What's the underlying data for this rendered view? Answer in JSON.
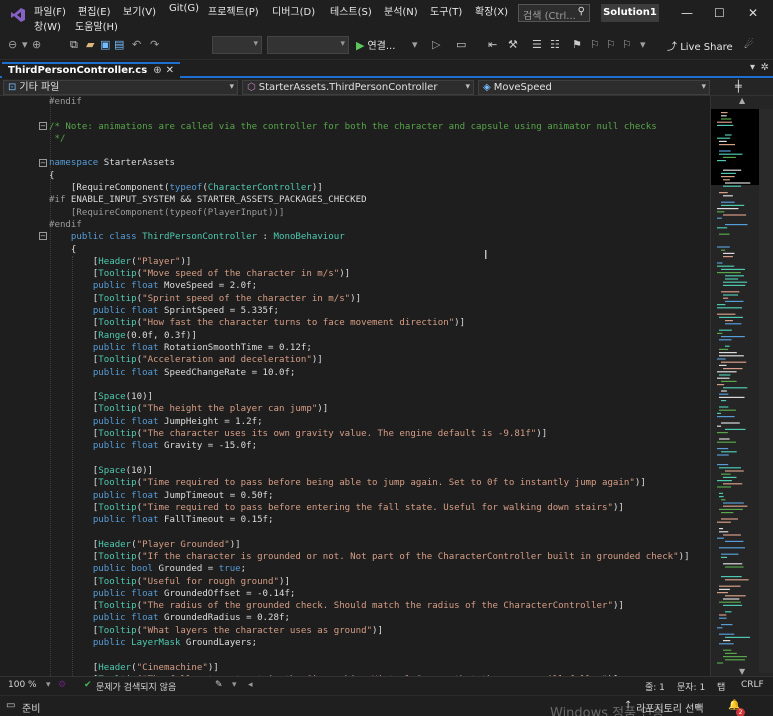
{
  "menu": [
    "파일(F)",
    "편집(E)",
    "보기(V)",
    "Git(G)",
    "프로젝트(P)",
    "디버그(D)",
    "테스트(S)",
    "분석(N)",
    "도구(T)",
    "확장(X)",
    "창(W)",
    "도움말(H)"
  ],
  "search": {
    "placeholder": "검색 (Ctrl...",
    "icon": "search-icon"
  },
  "solution_name": "Solution1",
  "window_controls": {
    "minimize": "—",
    "maximize": "☐",
    "close": "✕"
  },
  "toolbar": {
    "start_label": "연결...",
    "live_share": "Live Share"
  },
  "tab": {
    "title": "ThirdPersonController.cs",
    "pin": "⊕",
    "close": "✕"
  },
  "navbar": {
    "project": "기타 파일",
    "class": "StarterAssets.ThirdPersonController",
    "member": "MoveSpeed"
  },
  "code_lines": [
    [
      [
        "pp",
        "#endif"
      ]
    ],
    [
      [
        "tx",
        ""
      ]
    ],
    [
      [
        "cm",
        "/* Note: animations are called via the controller for both the character and capsule using animator null checks"
      ]
    ],
    [
      [
        "cm",
        " */"
      ]
    ],
    [
      [
        "tx",
        ""
      ]
    ],
    [
      [
        "kw",
        "namespace"
      ],
      [
        "tx",
        " StarterAssets"
      ]
    ],
    [
      [
        "tx",
        "{"
      ]
    ],
    [
      [
        "tx",
        "    [RequireComponent("
      ],
      [
        "kw",
        "typeof"
      ],
      [
        "tx",
        "("
      ],
      [
        "ty",
        "CharacterController"
      ],
      [
        "tx",
        ")]"
      ]
    ],
    [
      [
        "pp",
        "#if"
      ],
      [
        "tx",
        " ENABLE_INPUT_SYSTEM && STARTER_ASSETS_PACKAGES_CHECKED"
      ]
    ],
    [
      [
        "pp",
        "    [RequireComponent(typeof(PlayerInput))]"
      ]
    ],
    [
      [
        "pp",
        "#endif"
      ]
    ],
    [
      [
        "tx",
        "    "
      ],
      [
        "kw",
        "public class"
      ],
      [
        "tx",
        " "
      ],
      [
        "ty",
        "ThirdPersonController"
      ],
      [
        "tx",
        " : "
      ],
      [
        "ty",
        "MonoBehaviour"
      ]
    ],
    [
      [
        "tx",
        "    {"
      ]
    ],
    [
      [
        "tx",
        "        ["
      ],
      [
        "ty",
        "Header"
      ],
      [
        "tx",
        "("
      ],
      [
        "st",
        "\"Player\""
      ],
      [
        "tx",
        ")]"
      ]
    ],
    [
      [
        "tx",
        "        ["
      ],
      [
        "ty",
        "Tooltip"
      ],
      [
        "tx",
        "("
      ],
      [
        "st",
        "\"Move speed of the character in m/s\""
      ],
      [
        "tx",
        ")]"
      ]
    ],
    [
      [
        "tx",
        "        "
      ],
      [
        "kw",
        "public float"
      ],
      [
        "tx",
        " MoveSpeed = 2.0f;"
      ]
    ],
    [
      [
        "tx",
        "        ["
      ],
      [
        "ty",
        "Tooltip"
      ],
      [
        "tx",
        "("
      ],
      [
        "st",
        "\"Sprint speed of the character in m/s\""
      ],
      [
        "tx",
        ")]"
      ]
    ],
    [
      [
        "tx",
        "        "
      ],
      [
        "kw",
        "public float"
      ],
      [
        "tx",
        " SprintSpeed = 5.335f;"
      ]
    ],
    [
      [
        "tx",
        "        ["
      ],
      [
        "ty",
        "Tooltip"
      ],
      [
        "tx",
        "("
      ],
      [
        "st",
        "\"How fast the character turns to face movement direction\""
      ],
      [
        "tx",
        ")]"
      ]
    ],
    [
      [
        "tx",
        "        ["
      ],
      [
        "ty",
        "Range"
      ],
      [
        "tx",
        "(0.0f, 0.3f)]"
      ]
    ],
    [
      [
        "tx",
        "        "
      ],
      [
        "kw",
        "public float"
      ],
      [
        "tx",
        " RotationSmoothTime = 0.12f;"
      ]
    ],
    [
      [
        "tx",
        "        ["
      ],
      [
        "ty",
        "Tooltip"
      ],
      [
        "tx",
        "("
      ],
      [
        "st",
        "\"Acceleration and deceleration\""
      ],
      [
        "tx",
        ")]"
      ]
    ],
    [
      [
        "tx",
        "        "
      ],
      [
        "kw",
        "public float"
      ],
      [
        "tx",
        " SpeedChangeRate = 10.0f;"
      ]
    ],
    [
      [
        "tx",
        ""
      ]
    ],
    [
      [
        "tx",
        "        ["
      ],
      [
        "ty",
        "Space"
      ],
      [
        "tx",
        "(10)]"
      ]
    ],
    [
      [
        "tx",
        "        ["
      ],
      [
        "ty",
        "Tooltip"
      ],
      [
        "tx",
        "("
      ],
      [
        "st",
        "\"The height the player can jump\""
      ],
      [
        "tx",
        ")]"
      ]
    ],
    [
      [
        "tx",
        "        "
      ],
      [
        "kw",
        "public float"
      ],
      [
        "tx",
        " JumpHeight = 1.2f;"
      ]
    ],
    [
      [
        "tx",
        "        ["
      ],
      [
        "ty",
        "Tooltip"
      ],
      [
        "tx",
        "("
      ],
      [
        "st",
        "\"The character uses its own gravity value. The engine default is -9.81f\""
      ],
      [
        "tx",
        ")]"
      ]
    ],
    [
      [
        "tx",
        "        "
      ],
      [
        "kw",
        "public float"
      ],
      [
        "tx",
        " Gravity = -15.0f;"
      ]
    ],
    [
      [
        "tx",
        ""
      ]
    ],
    [
      [
        "tx",
        "        ["
      ],
      [
        "ty",
        "Space"
      ],
      [
        "tx",
        "(10)]"
      ]
    ],
    [
      [
        "tx",
        "        ["
      ],
      [
        "ty",
        "Tooltip"
      ],
      [
        "tx",
        "("
      ],
      [
        "st",
        "\"Time required to pass before being able to jump again. Set to 0f to instantly jump again\""
      ],
      [
        "tx",
        ")]"
      ]
    ],
    [
      [
        "tx",
        "        "
      ],
      [
        "kw",
        "public float"
      ],
      [
        "tx",
        " JumpTimeout = 0.50f;"
      ]
    ],
    [
      [
        "tx",
        "        ["
      ],
      [
        "ty",
        "Tooltip"
      ],
      [
        "tx",
        "("
      ],
      [
        "st",
        "\"Time required to pass before entering the fall state. Useful for walking down stairs\""
      ],
      [
        "tx",
        ")]"
      ]
    ],
    [
      [
        "tx",
        "        "
      ],
      [
        "kw",
        "public float"
      ],
      [
        "tx",
        " FallTimeout = 0.15f;"
      ]
    ],
    [
      [
        "tx",
        ""
      ]
    ],
    [
      [
        "tx",
        "        ["
      ],
      [
        "ty",
        "Header"
      ],
      [
        "tx",
        "("
      ],
      [
        "st",
        "\"Player Grounded\""
      ],
      [
        "tx",
        ")]"
      ]
    ],
    [
      [
        "tx",
        "        ["
      ],
      [
        "ty",
        "Tooltip"
      ],
      [
        "tx",
        "("
      ],
      [
        "st",
        "\"If the character is grounded or not. Not part of the CharacterController built in grounded check\""
      ],
      [
        "tx",
        ")]"
      ]
    ],
    [
      [
        "tx",
        "        "
      ],
      [
        "kw",
        "public bool"
      ],
      [
        "tx",
        " Grounded = "
      ],
      [
        "kw",
        "true"
      ],
      [
        "tx",
        ";"
      ]
    ],
    [
      [
        "tx",
        "        ["
      ],
      [
        "ty",
        "Tooltip"
      ],
      [
        "tx",
        "("
      ],
      [
        "st",
        "\"Useful for rough ground\""
      ],
      [
        "tx",
        ")]"
      ]
    ],
    [
      [
        "tx",
        "        "
      ],
      [
        "kw",
        "public float"
      ],
      [
        "tx",
        " GroundedOffset = -0.14f;"
      ]
    ],
    [
      [
        "tx",
        "        ["
      ],
      [
        "ty",
        "Tooltip"
      ],
      [
        "tx",
        "("
      ],
      [
        "st",
        "\"The radius of the grounded check. Should match the radius of the CharacterController\""
      ],
      [
        "tx",
        ")]"
      ]
    ],
    [
      [
        "tx",
        "        "
      ],
      [
        "kw",
        "public float"
      ],
      [
        "tx",
        " GroundedRadius = 0.28f;"
      ]
    ],
    [
      [
        "tx",
        "        ["
      ],
      [
        "ty",
        "Tooltip"
      ],
      [
        "tx",
        "("
      ],
      [
        "st",
        "\"What layers the character uses as ground\""
      ],
      [
        "tx",
        ")]"
      ]
    ],
    [
      [
        "tx",
        "        "
      ],
      [
        "kw",
        "public"
      ],
      [
        "tx",
        " "
      ],
      [
        "ty",
        "LayerMask"
      ],
      [
        "tx",
        " GroundLayers;"
      ]
    ],
    [
      [
        "tx",
        ""
      ]
    ],
    [
      [
        "tx",
        "        ["
      ],
      [
        "ty",
        "Header"
      ],
      [
        "tx",
        "("
      ],
      [
        "st",
        "\"Cinemachine\""
      ],
      [
        "tx",
        ")]"
      ]
    ],
    [
      [
        "tx",
        "        ["
      ],
      [
        "ty",
        "Tooltip"
      ],
      [
        "tx",
        "("
      ],
      [
        "st",
        "\"The follow target set in the Cinemachine Virtual Camera that the camera will follow\""
      ],
      [
        "tx",
        ")]"
      ]
    ]
  ],
  "editor_status": {
    "zoom": "100 %",
    "issues": "문제가 검색되지 않음",
    "line": "줄: 1",
    "col": "문자: 1",
    "tab": "탭",
    "eol": "CRLF"
  },
  "statusbar": {
    "ready": "준비",
    "watermark": "Windows 정품 인증",
    "repo": "리포지토리 선택",
    "notifications": "2"
  },
  "colors": {
    "keyword": "#569cd6",
    "type": "#4ec9b0",
    "string": "#d69d85",
    "comment": "#57a64a",
    "preprocessor": "#9b9b9b",
    "accent": "#1f6fd1"
  }
}
